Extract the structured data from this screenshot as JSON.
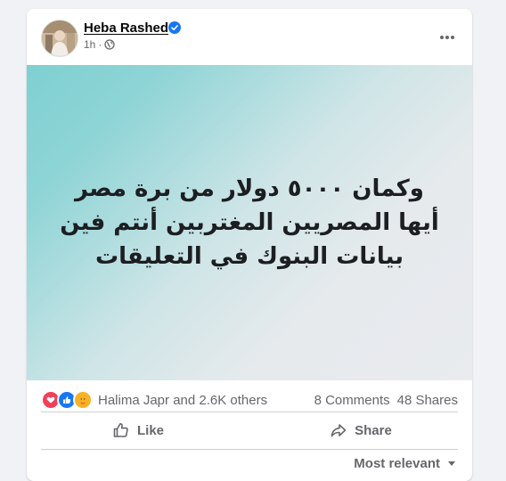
{
  "post": {
    "author": "Heba Rashed",
    "time": "1h",
    "text_lines": [
      "وكمان ٥٠٠٠ دولار من برة مصر",
      "أيها المصريين المغتربين أنتم فين",
      "بيانات البنوك في التعليقات"
    ],
    "background_gradient": [
      "#7fd0d1",
      "#e9ebee"
    ]
  },
  "engagement": {
    "reaction_icons": [
      "love-reaction",
      "like-reaction",
      "care-reaction"
    ],
    "reactors": "Halima Japr and 2.6K others",
    "comments": "8 Comments",
    "shares": "48 Shares"
  },
  "actions": {
    "like": "Like",
    "share": "Share"
  },
  "comments_sort": "Most relevant",
  "colors": {
    "verified": "#1877f2",
    "secondary_text": "#65676b",
    "love": "#f33e58",
    "like": "#1877f2",
    "care": "#f7b125"
  }
}
